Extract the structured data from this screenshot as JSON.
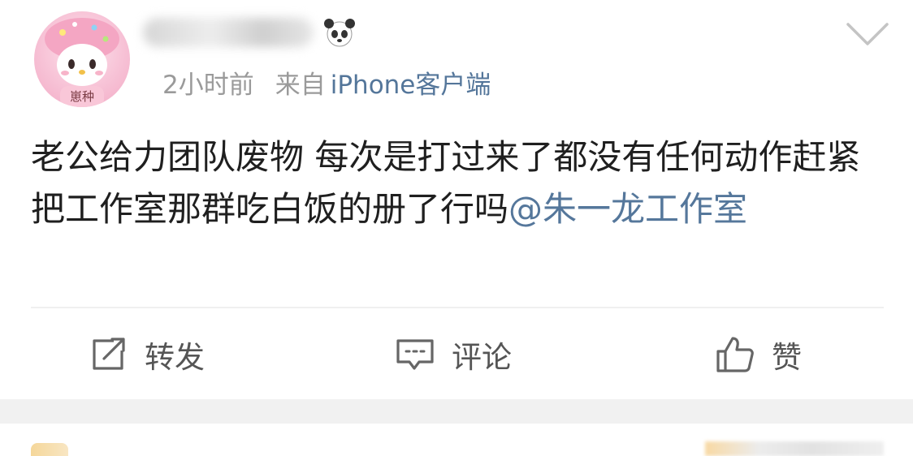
{
  "post": {
    "avatar_tag": "崽种",
    "time": "2小时前",
    "from_label": "来自",
    "client": "iPhone客户端",
    "content_text": "老公给力团队废物 每次是打过来了都没有任何动作赶紧把工作室那群吃白饭的册了行吗",
    "mention": "@朱一龙工作室"
  },
  "actions": {
    "repost_label": "转发",
    "comment_label": "评论",
    "like_label": "赞"
  },
  "colors": {
    "link": "#54769a",
    "meta": "#9a9a9a",
    "text": "#1f1f1f",
    "action": "#555555",
    "separator": "#f1f1f1"
  },
  "icons": [
    "panda-emoji-icon",
    "chevron-down-icon",
    "repost-icon",
    "comment-icon",
    "like-icon"
  ]
}
